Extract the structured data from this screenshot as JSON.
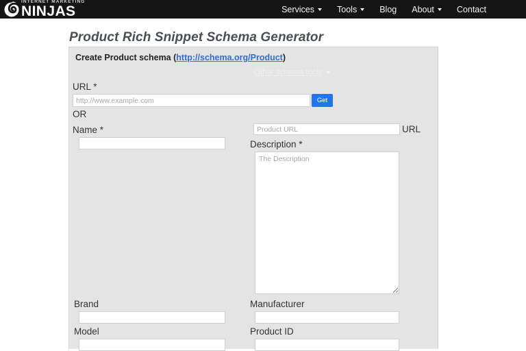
{
  "header": {
    "logo": {
      "kicker": "INTERNET MARKETING",
      "name": "NINJAS",
      "icon": "spiral-logo-icon"
    },
    "nav": [
      {
        "label": "Services",
        "has_caret": true
      },
      {
        "label": "Tools",
        "has_caret": true
      },
      {
        "label": "Blog",
        "has_caret": false
      },
      {
        "label": "About",
        "has_caret": true
      },
      {
        "label": "Contact",
        "has_caret": false
      }
    ]
  },
  "page": {
    "title": "Product Rich Snippet Schema Generator"
  },
  "panel": {
    "heading_prefix": "Create Product schema (",
    "heading_link": "http://schema.org/Product",
    "heading_suffix": ")",
    "other_tools_label": "Other schema tools",
    "fields": {
      "url_label": "URL *",
      "url_placeholder": "http://www.example.com",
      "url_value": "",
      "get_button": "Get",
      "or_label": "OR",
      "name_label": "Name *",
      "name_value": "",
      "product_url_placeholder": "Product URL",
      "product_url_value": "",
      "product_url_label": "URL",
      "description_label": "Description *",
      "description_placeholder": "The Description",
      "description_value": "",
      "brand_label": "Brand",
      "brand_value": "",
      "manufacturer_label": "Manufacturer",
      "manufacturer_value": "",
      "model_label": "Model",
      "model_value": "",
      "product_id_label": "Product ID",
      "product_id_value": ""
    }
  },
  "colors": {
    "header_bg": "#151515",
    "panel_bg": "#e4e4e4",
    "accent_blue": "#2176f0",
    "link_blue": "#2a6ed8",
    "title_gray": "#4a4f55"
  }
}
